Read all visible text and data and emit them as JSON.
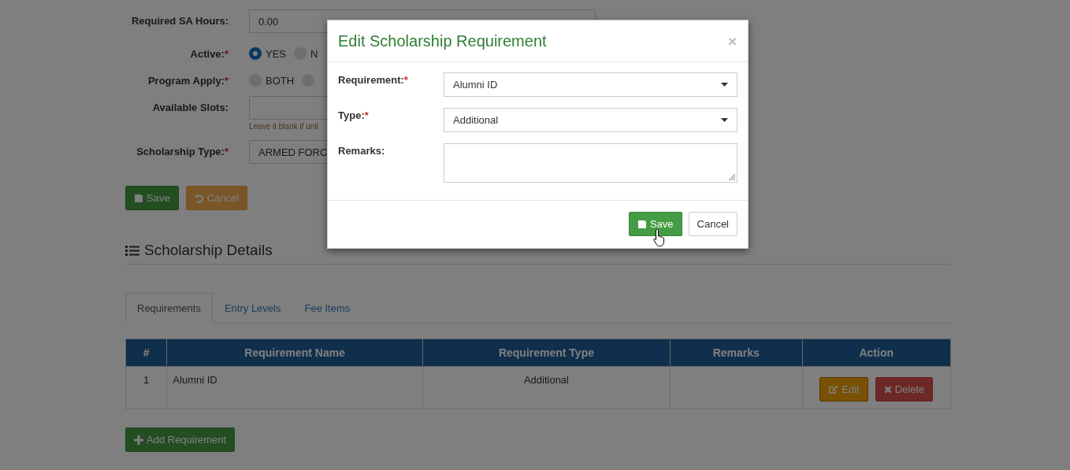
{
  "required_mark": "*",
  "form": {
    "fields": [
      {
        "kind": "text",
        "label": "Required SA Hours:",
        "required": false,
        "value": "0.00"
      },
      {
        "kind": "radio",
        "label": "Active:",
        "required": true,
        "options": [
          {
            "label": "YES",
            "selected": true
          },
          {
            "label": "N",
            "selected": false
          }
        ]
      },
      {
        "kind": "radio",
        "label": "Program Apply:",
        "required": true,
        "options": [
          {
            "label": "BOTH",
            "selected": false
          },
          {
            "selected": false
          }
        ]
      },
      {
        "kind": "text",
        "label": "Available Slots:",
        "required": false,
        "help": "Leave it blank if unli"
      },
      {
        "kind": "select",
        "label": "Scholarship Type:",
        "required": true,
        "value": "ARMED FORC"
      }
    ],
    "buttons": [
      {
        "kind": "save",
        "label": "Save"
      },
      {
        "kind": "cancel",
        "label": "Cancel"
      }
    ]
  },
  "section": {
    "title": "Scholarship Details"
  },
  "tabs": [
    {
      "label": "Requirements",
      "selected": true
    },
    {
      "label": "Entry Levels",
      "selected": false
    },
    {
      "label": "Fee Items",
      "selected": false
    }
  ],
  "table": {
    "columns": [
      "#",
      "Requirement Name",
      "Requirement Type",
      "Remarks",
      "Action"
    ],
    "rows": [
      {
        "cells": [
          "1",
          "Alumni ID",
          "Additional",
          null
        ],
        "actions": [
          {
            "kind": "edit",
            "label": "Edit"
          },
          {
            "kind": "delete",
            "label": "Delete"
          }
        ]
      }
    ]
  },
  "add_button": "Add Requirement",
  "modal": {
    "title": "Edit Scholarship Requirement",
    "close": "×",
    "fields": [
      {
        "kind": "select",
        "label": "Requirement:",
        "required": true,
        "value": "Alumni ID"
      },
      {
        "kind": "select",
        "label": "Type:",
        "required": true,
        "value": "Additional"
      },
      {
        "kind": "textarea",
        "label": "Remarks:",
        "required": false
      }
    ],
    "buttons": [
      {
        "kind": "save",
        "label": "Save"
      },
      {
        "kind": "cancel",
        "label": "Cancel"
      }
    ]
  }
}
